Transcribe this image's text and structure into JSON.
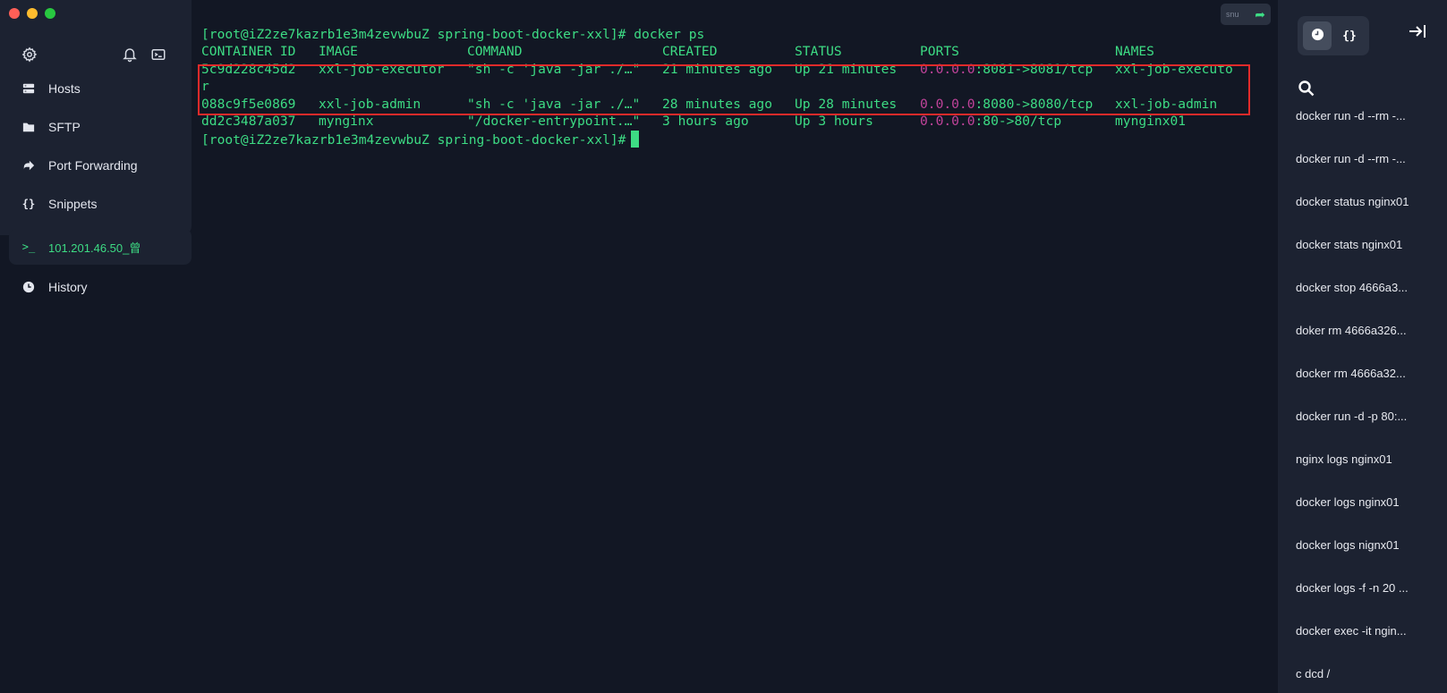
{
  "sidebar": {
    "nav": [
      {
        "label": "Hosts",
        "icon": "hosts-icon"
      },
      {
        "label": "SFTP",
        "icon": "folder-icon"
      },
      {
        "label": "Port Forwarding",
        "icon": "forward-arrow-icon"
      },
      {
        "label": "Snippets",
        "icon": "braces-icon"
      }
    ],
    "session": {
      "label": "101.201.46.50_曾",
      "icon": "terminal-prompt-icon"
    },
    "history": {
      "label": "History",
      "icon": "clock-icon"
    }
  },
  "terminal": {
    "prompt": "[root@iZ2ze7kazrb1e3m4zevwbuZ spring-boot-docker-xxl]#",
    "command": " docker ps",
    "headers": {
      "id": "CONTAINER ID",
      "image": "IMAGE",
      "command": "COMMAND",
      "created": "CREATED",
      "status": "STATUS",
      "ports": "PORTS",
      "names": "NAMES"
    },
    "rows": [
      {
        "id": "5c9d228c45d2",
        "image": "xxl-job-executor",
        "command": "\"sh -c 'java -jar ./…\"",
        "created": "21 minutes ago",
        "status": "Up 21 minutes",
        "ports_ip": "0.0.0.0",
        "ports_rest": ":8081->8081/tcp",
        "names": "xxl-job-executo",
        "names_wrap": "r"
      },
      {
        "id": "088c9f5e0869",
        "image": "xxl-job-admin",
        "command": "\"sh -c 'java -jar ./…\"",
        "created": "28 minutes ago",
        "status": "Up 28 minutes",
        "ports_ip": "0.0.0.0",
        "ports_rest": ":8080->8080/tcp",
        "names": "xxl-job-admin"
      },
      {
        "id": "dd2c3487a037",
        "image": "mynginx",
        "command": "\"/docker-entrypoint.…\"",
        "created": "3 hours ago",
        "status": "Up 3 hours",
        "ports_ip": "0.0.0.0",
        "ports_rest": ":80->80/tcp",
        "names": "mynginx01"
      }
    ],
    "toggle_label": "snu",
    "colors": {
      "text": "#3ddc84",
      "ip": "#c0439a",
      "highlight": "#e22a2a",
      "background": "#121724"
    }
  },
  "right_panel": {
    "tabs": [
      {
        "name": "history-tab",
        "icon": "clock-icon"
      },
      {
        "name": "snippets-tab",
        "label": "{}"
      }
    ],
    "history_items": [
      "docker run -d --rm -...",
      "docker run -d --rm -...",
      "docker status nginx01",
      "docker stats nginx01",
      "docker stop 4666a3...",
      "doker rm 4666a326...",
      "docker rm 4666a32...",
      "docker run -d -p 80:...",
      "nginx logs nginx01",
      "docker logs nginx01",
      "docker logs nignx01",
      "docker logs -f -n 20 ...",
      "docker exec -it ngin...",
      "c dcd /"
    ]
  }
}
